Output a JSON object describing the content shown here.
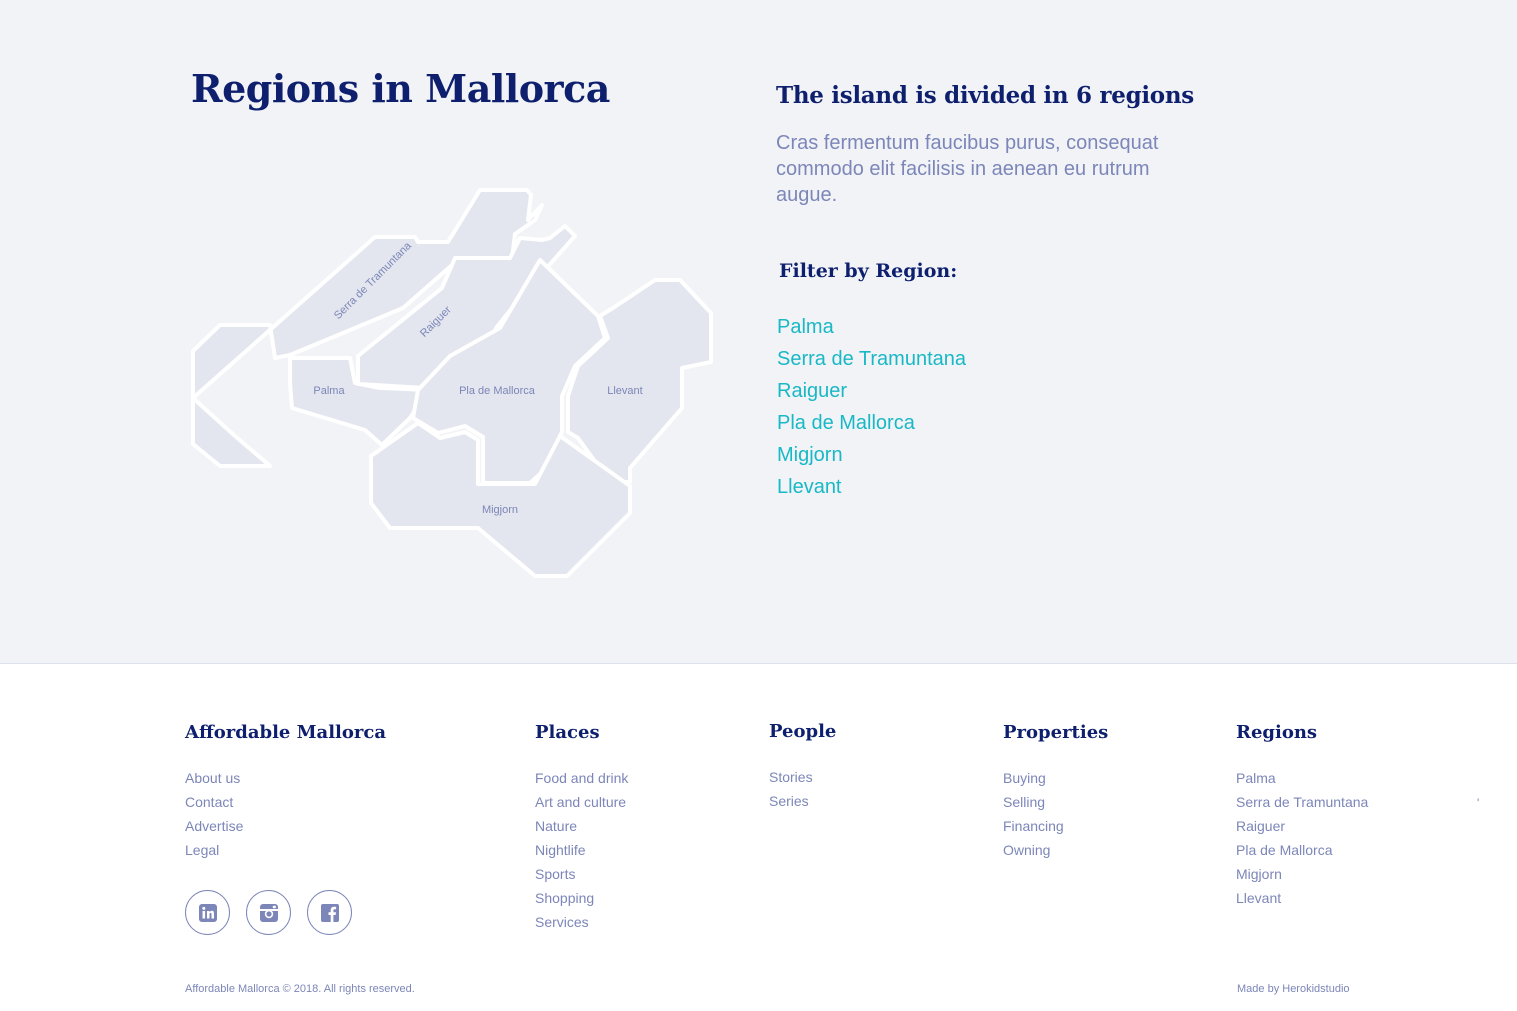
{
  "hero": {
    "title": "Regions in Mallorca",
    "subtitle": "The island is divided in 6 regions",
    "description": "Cras fermentum faucibus purus, consequat commodo elit facilisis in aenean eu rutrum augue.",
    "filter_title": "Filter by Region:",
    "filter_regions": [
      "Palma",
      "Serra de Tramuntana",
      "Raiguer",
      "Pla de Mallorca",
      "Migjorn",
      "Llevant"
    ]
  },
  "map": {
    "labels": {
      "serra": "Serra de Tramuntana",
      "raiguer": "Raiguer",
      "palma": "Palma",
      "pla": "Pla de Mallorca",
      "llevant": "Llevant",
      "migjorn": "Migjorn"
    }
  },
  "footer": {
    "brand": {
      "title": "Affordable Mallorca",
      "links": [
        "About us",
        "Contact",
        "Advertise",
        "Legal"
      ]
    },
    "places": {
      "title": "Places",
      "links": [
        "Food and drink",
        "Art and culture",
        "Nature",
        "Nightlife",
        "Sports",
        "Shopping",
        "Services"
      ]
    },
    "people": {
      "title": "People",
      "links": [
        "Stories",
        "Series"
      ]
    },
    "properties": {
      "title": "Properties",
      "links": [
        "Buying",
        "Selling",
        "Financing",
        "Owning"
      ]
    },
    "regions": {
      "title": "Regions",
      "links": [
        "Palma",
        "Serra de Tramuntana",
        "Raiguer",
        "Pla de Mallorca",
        "Migjorn",
        "Llevant"
      ]
    },
    "socials": [
      "linkedin-icon",
      "instagram-icon",
      "facebook-icon"
    ],
    "copyright": "Affordable Mallorca © 2018. All rights reserved.",
    "credit": "Made by Herokidstudio",
    "edge_mark": "'"
  },
  "colors": {
    "heading": "#0e1f6e",
    "body_text": "#7c86b8",
    "accent": "#19b8c5",
    "hero_bg": "#f1f3f7",
    "region_fill": "#e3e6ee"
  }
}
